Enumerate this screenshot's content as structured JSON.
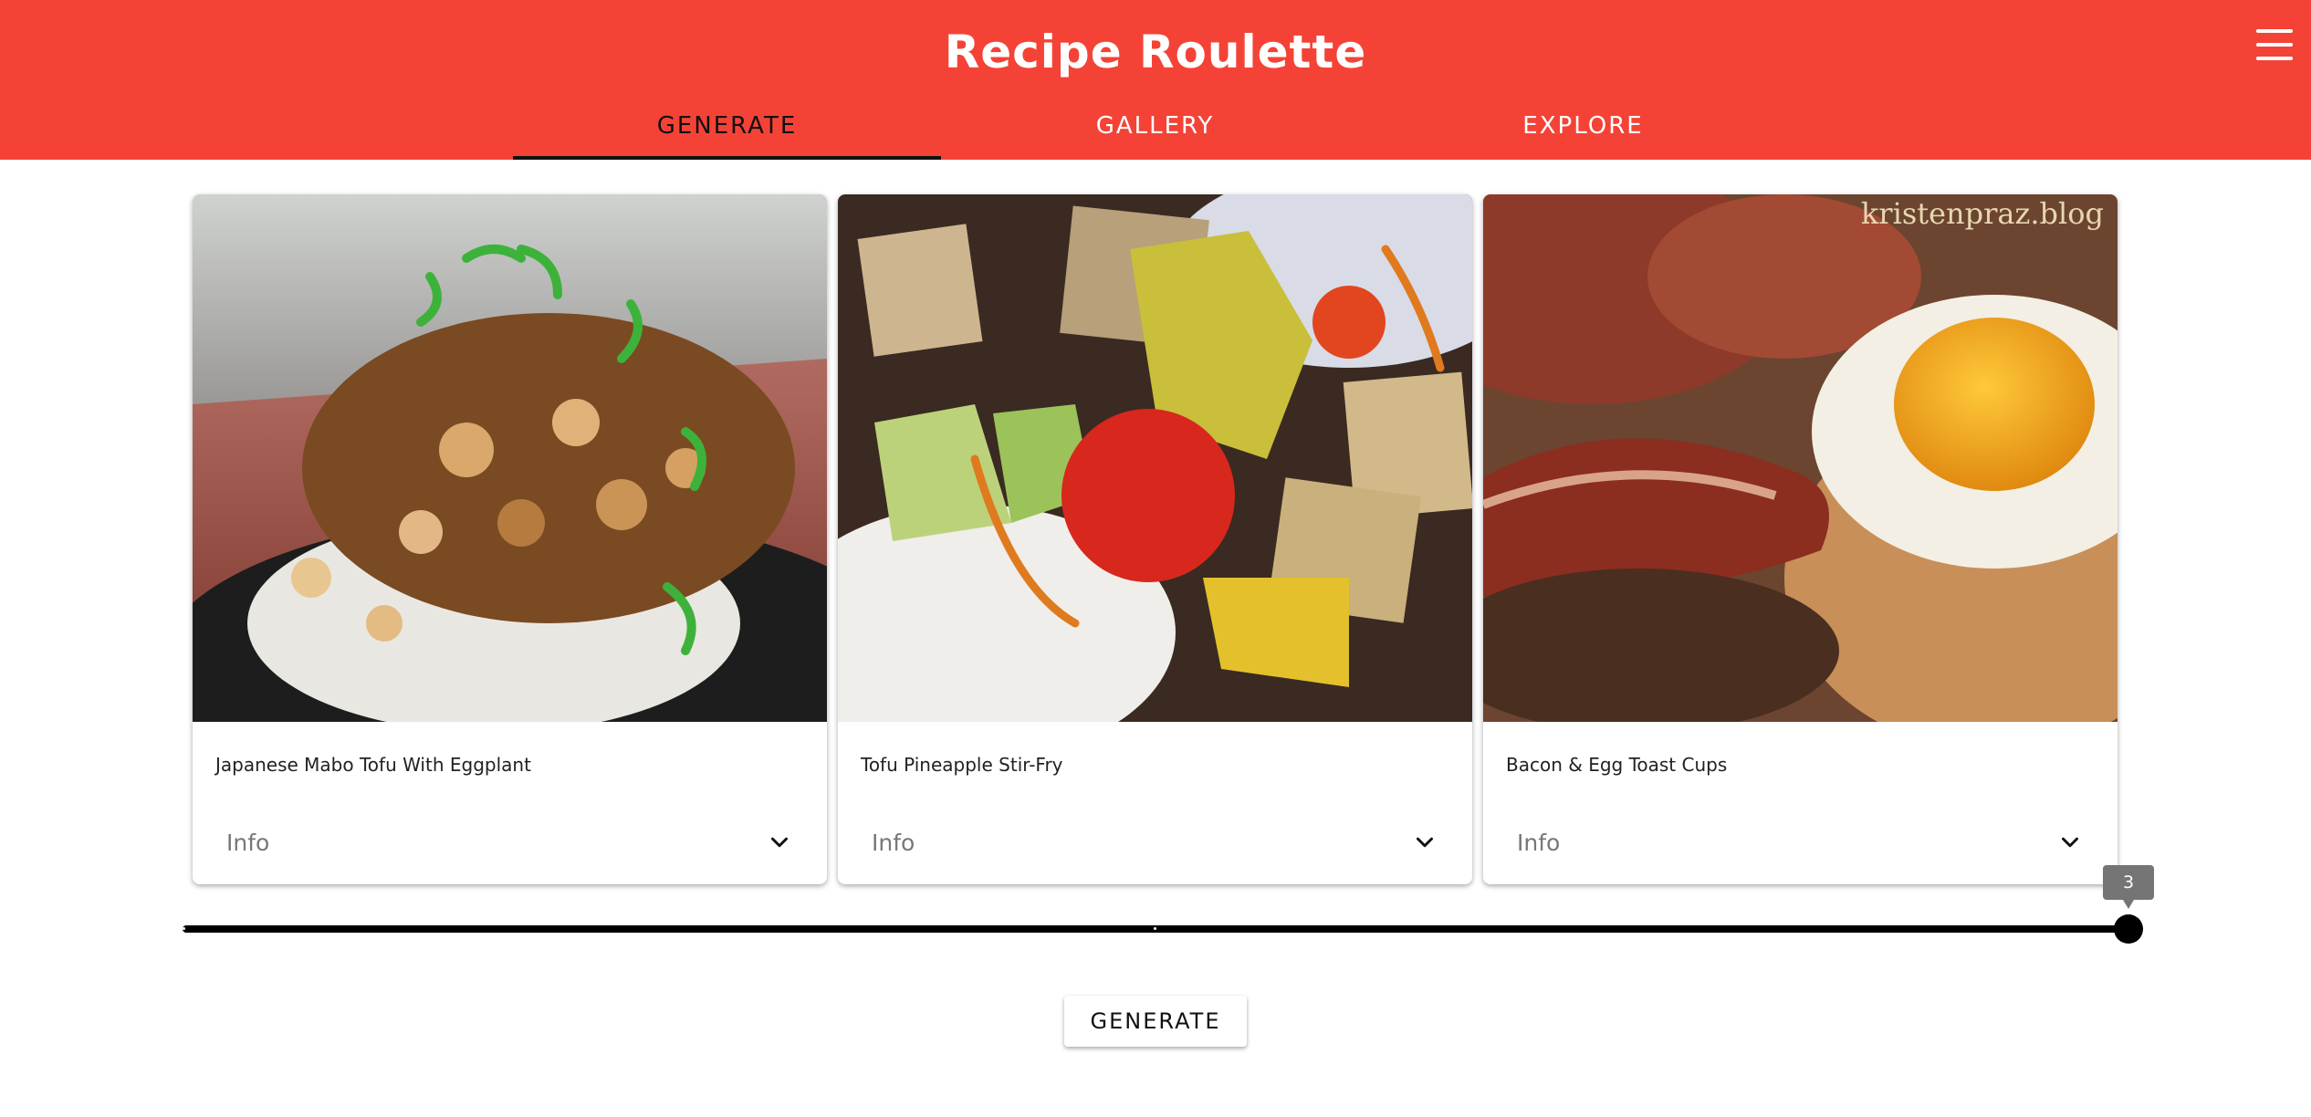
{
  "app": {
    "title": "Recipe Roulette",
    "colors": {
      "appbar": "#f44336",
      "accent": "#000000"
    }
  },
  "header": {
    "menu_icon": "hamburger-menu-icon",
    "tabs": [
      {
        "label": "GENERATE",
        "active": true
      },
      {
        "label": "GALLERY",
        "active": false
      },
      {
        "label": "EXPLORE",
        "active": false
      }
    ]
  },
  "cards": [
    {
      "title": "Japanese Mabo Tofu With Eggplant",
      "info_label": "Info",
      "image": "mabo-tofu-over-rice-photo"
    },
    {
      "title": "Tofu Pineapple Stir-Fry",
      "info_label": "Info",
      "image": "tofu-pineapple-stir-fry-photo"
    },
    {
      "title": "Bacon & Egg Toast Cups",
      "info_label": "Info",
      "image": "bacon-egg-toast-cup-photo",
      "watermark": "kristenpraz.blog"
    }
  ],
  "slider": {
    "value": 3,
    "value_label": "3",
    "min": 1,
    "max": 3
  },
  "generate_button": {
    "label": "GENERATE"
  }
}
